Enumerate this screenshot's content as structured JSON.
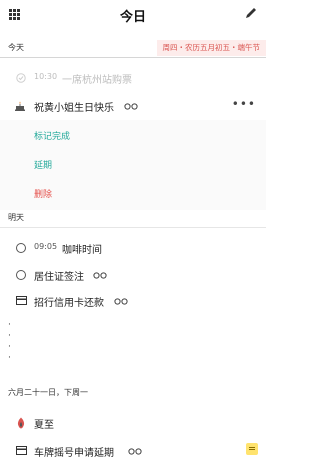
{
  "header": {
    "title": "今日",
    "menu_icon": "grid-icon",
    "edit_icon": "pencil-icon"
  },
  "today": {
    "label": "今天",
    "lunar": "周四・农历五月初五・端午节",
    "items": [
      {
        "time": "10:30",
        "text": "一席杭州站购票",
        "done": true
      },
      {
        "text": "祝黄小姐生日快乐",
        "icon": "cake-icon"
      }
    ],
    "more": "•••",
    "actions": [
      {
        "label": "标记完成",
        "color": "#23a99a"
      },
      {
        "label": "延期",
        "color": "#23a99a"
      },
      {
        "label": "删除",
        "color": "#e5504b"
      }
    ]
  },
  "tomorrow": {
    "label": "明天",
    "items": [
      {
        "time": "09:05",
        "text": "咖啡时间"
      },
      {
        "text": "居住证签注"
      },
      {
        "text": "招行信用卡还款",
        "icon": "card-icon"
      }
    ]
  },
  "later": {
    "label": "六月二十一日，下周一",
    "items": [
      {
        "text": "夏至",
        "icon": "flame-icon"
      },
      {
        "text": "车牌摇号申请延期",
        "icon": "card-icon"
      }
    ]
  },
  "colors": {
    "accent": "#23a99a",
    "danger": "#e5504b",
    "lunar_bg": "#fdeceb",
    "lunar_text": "#d9534f"
  }
}
